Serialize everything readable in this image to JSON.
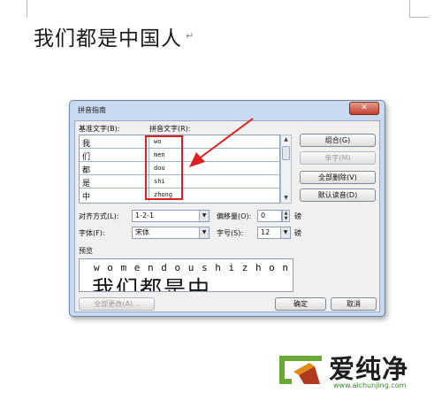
{
  "document": {
    "text": "我们都是中国人",
    "paragraph_mark": "↵"
  },
  "dialog": {
    "title": "拼音指南",
    "close_label": "✕",
    "base_text_header": "基准文字(B):",
    "pinyin_text_header": "拼音文字(R):",
    "rows": [
      {
        "base": "我",
        "pinyin": "wo"
      },
      {
        "base": "们",
        "pinyin": "men"
      },
      {
        "base": "都",
        "pinyin": "dou"
      },
      {
        "base": "是",
        "pinyin": "shi"
      },
      {
        "base": "中",
        "pinyin": "zhong"
      }
    ],
    "buttons": {
      "combine": "组合(G)",
      "single": "单字(M)",
      "clear_all": "全部删除(V)",
      "default_reading": "默认读音(D)",
      "change_all": "全部更改(A)...",
      "ok": "确定",
      "cancel": "取消"
    },
    "alignment_label": "对齐方式(L):",
    "alignment_value": "1-2-1",
    "offset_label": "偏移量(O):",
    "offset_value": "0",
    "offset_unit": "磅",
    "font_label": "字体(F):",
    "font_value": "宋体",
    "size_label": "字号(S):",
    "size_value": "12",
    "size_unit": "磅",
    "preview_label": "预览",
    "preview_pinyin": "w o m e n d o u s h i z h o n g",
    "preview_hanzi": "我们都是中"
  },
  "watermark": {
    "brand": "爱纯净",
    "url": "www.aichunjing.com"
  },
  "colors": {
    "annotation": "#e02020",
    "brand_green": "#3a8a2a"
  }
}
